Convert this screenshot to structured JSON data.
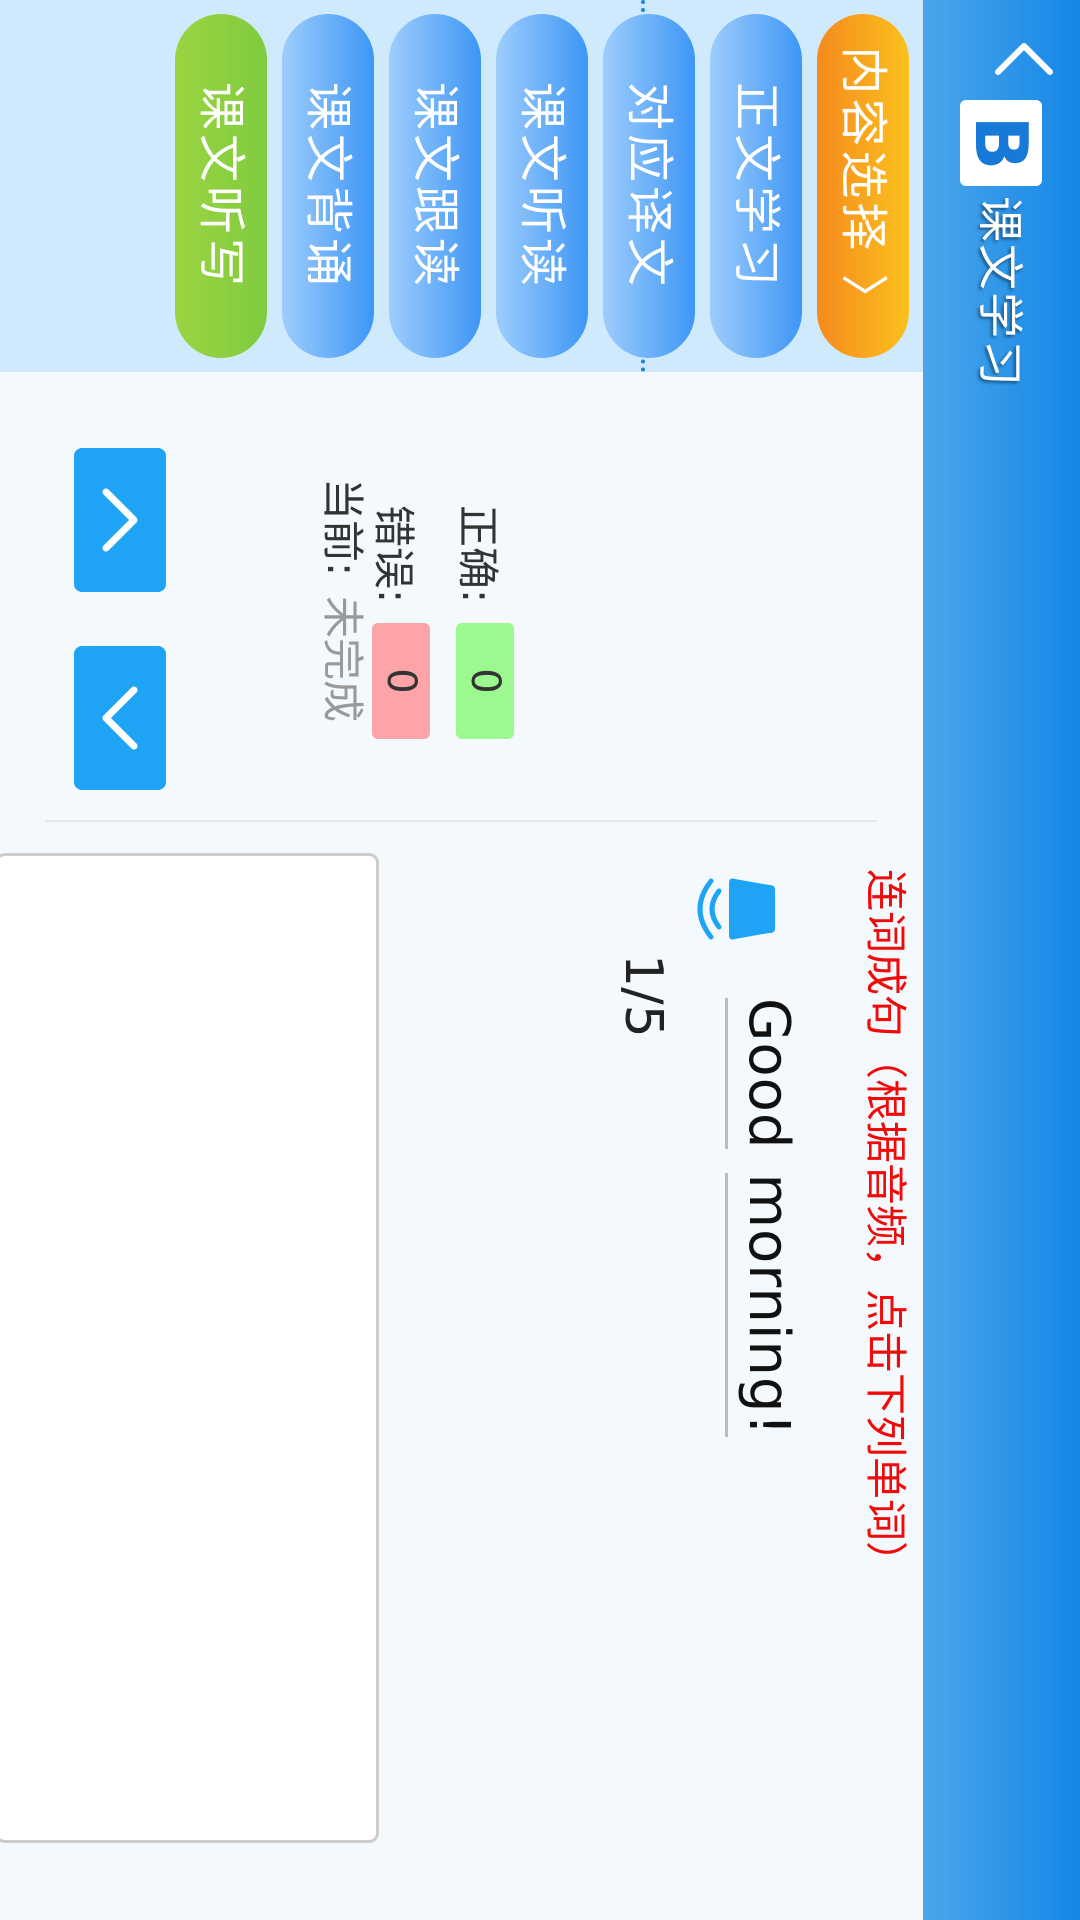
{
  "header": {
    "back_icon": "chevron-left-icon",
    "logo_letter": "B",
    "title": "课文学习"
  },
  "tabs": [
    {
      "label": "内容选择 〉",
      "style": "orange"
    },
    {
      "label": "正文学习",
      "style": "blue"
    },
    {
      "label": "对应译文",
      "style": "blue"
    },
    {
      "label": "课文听读",
      "style": "blue"
    },
    {
      "label": "课文跟读",
      "style": "blue"
    },
    {
      "label": "课文背诵",
      "style": "blue"
    },
    {
      "label": "课文听写",
      "style": "green",
      "active": true
    }
  ],
  "progress": "1/5",
  "stats": {
    "correct_label": "正确:",
    "correct_value": "0",
    "wrong_label": "错误:",
    "wrong_value": "0",
    "current_label": "当前:",
    "current_value": "未完成"
  },
  "nav": {
    "up_icon": "chevron-up-icon",
    "down_icon": "chevron-down-icon"
  },
  "exercise": {
    "instruction": "连词成句（根据音频，点击下列单词）",
    "sound_icon": "bell-sound-icon",
    "words": [
      "Good",
      "morning!"
    ],
    "answer_value": ""
  },
  "colors": {
    "header_blue": "#1587e6",
    "tab_orange": "#f68a1e",
    "tab_blue": "#3d96f5",
    "tab_green": "#8ed040",
    "accent_button": "#1ea3f5",
    "instruction_red": "#f00a0a",
    "badge_correct": "#9cf98f",
    "badge_wrong": "#fca4a7"
  }
}
